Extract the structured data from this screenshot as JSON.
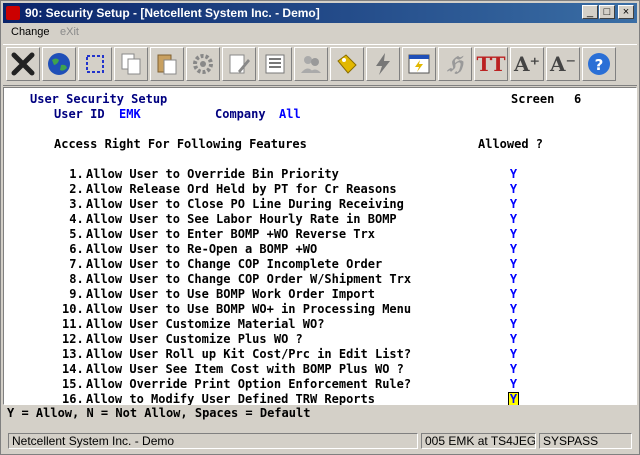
{
  "window": {
    "title": "90: Security Setup - [Netcellent System Inc. - Demo]",
    "controls": {
      "minimize": "_",
      "maximize": "□",
      "close": "×"
    }
  },
  "menu": {
    "items": [
      "Change",
      "eXit"
    ]
  },
  "toolbar": {
    "buttons": [
      "exit-icon",
      "globe-icon",
      "select-box-icon",
      "copy-icon",
      "paste-icon",
      "settings-icon",
      "edit-icon",
      "list-icon",
      "users-icon",
      "tag-icon",
      "lightning-icon",
      "calendar-lightning-icon",
      "signature-icon",
      "font-style-icon",
      "font-increase-icon",
      "font-decrease-icon",
      "help-icon"
    ],
    "glyphs": {
      "signature": "ℌ",
      "font_style": "TT",
      "font_increase": "A⁺",
      "font_decrease": "A⁻",
      "help": "?"
    }
  },
  "screen": {
    "title": "User Security Setup",
    "screen_label": "Screen",
    "screen_number": "6",
    "user_label": "User ID",
    "user_value": "EMK",
    "company_label": "Company",
    "company_value": "All",
    "features_header": "Access Right For Following Features",
    "allowed_header": "Allowed ?",
    "features": [
      {
        "num": " 1.",
        "label": "Allow User to Override Bin Priority",
        "allowed": "Y"
      },
      {
        "num": " 2.",
        "label": "Allow Release Ord Held by PT for Cr Reasons",
        "allowed": "Y"
      },
      {
        "num": " 3.",
        "label": "Allow User to Close PO Line During Receiving",
        "allowed": "Y"
      },
      {
        "num": " 4.",
        "label": "Allow User to See Labor Hourly Rate in BOMP",
        "allowed": "Y"
      },
      {
        "num": " 5.",
        "label": "Allow User to Enter BOMP +WO Reverse Trx",
        "allowed": "Y"
      },
      {
        "num": " 6.",
        "label": "Allow User to Re-Open a BOMP +WO",
        "allowed": "Y"
      },
      {
        "num": " 7.",
        "label": "Allow User to Change COP Incomplete Order",
        "allowed": "Y"
      },
      {
        "num": " 8.",
        "label": "Allow User to Change COP Order W/Shipment Trx",
        "allowed": "Y"
      },
      {
        "num": " 9.",
        "label": "Allow User to Use BOMP Work Order Import",
        "allowed": "Y"
      },
      {
        "num": "10.",
        "label": "Allow User to Use BOMP WO+ in Processing Menu",
        "allowed": "Y"
      },
      {
        "num": "11.",
        "label": "Allow User Customize Material WO?",
        "allowed": "Y"
      },
      {
        "num": "12.",
        "label": "Allow User Customize Plus WO ?",
        "allowed": "Y"
      },
      {
        "num": "13.",
        "label": "Allow User Roll up Kit Cost/Prc in Edit List?",
        "allowed": "Y"
      },
      {
        "num": "14.",
        "label": "Allow User See Item Cost with BOMP Plus WO ?",
        "allowed": "Y"
      },
      {
        "num": "15.",
        "label": "Allow Override Print Option Enforcement Rule?",
        "allowed": "Y"
      },
      {
        "num": "16.",
        "label": "Allow to Modify User Defined TRW Reports",
        "allowed": "Y"
      }
    ]
  },
  "hint": "Y = Allow, N = Not Allow, Spaces = Default",
  "status": {
    "company": "Netcellent System Inc. - Demo",
    "session": "005 EMK at TS4JEG",
    "db": "SYSPASS"
  }
}
